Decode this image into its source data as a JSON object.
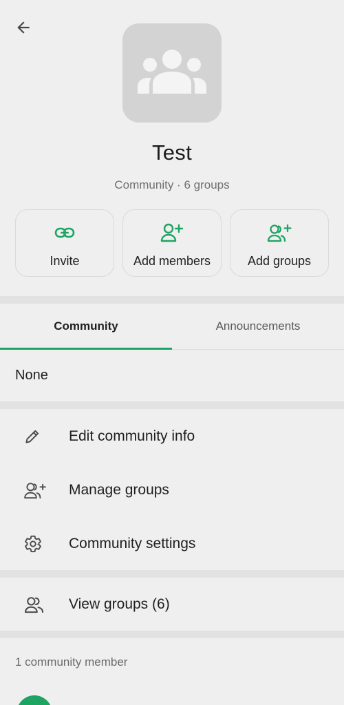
{
  "header": {
    "back_icon": "arrow-left-icon",
    "avatar_icon": "community-group-icon"
  },
  "community": {
    "name": "Test",
    "subtitle": "Community · 6 groups"
  },
  "actions": [
    {
      "label": "Invite",
      "icon": "link-icon"
    },
    {
      "label": "Add members",
      "icon": "person-add-icon"
    },
    {
      "label": "Add groups",
      "icon": "group-add-icon"
    }
  ],
  "tabs": [
    {
      "label": "Community",
      "active": true
    },
    {
      "label": "Announcements",
      "active": false
    }
  ],
  "community_description": "None",
  "menu": [
    {
      "label": "Edit community info",
      "icon": "pencil-icon"
    },
    {
      "label": "Manage groups",
      "icon": "manage-groups-icon"
    },
    {
      "label": "Community settings",
      "icon": "gear-icon"
    }
  ],
  "view_groups": {
    "label": "View groups (6)",
    "icon": "groups-icon"
  },
  "members": {
    "heading": "1 community member"
  },
  "colors": {
    "accent": "#1ea362",
    "background": "#efefef",
    "avatar_bg": "#d3d3d3"
  }
}
